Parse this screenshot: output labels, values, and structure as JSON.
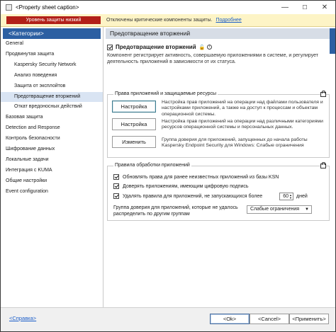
{
  "window": {
    "title": "<Property sheet caption>",
    "min_glyph": "—",
    "max_glyph": "☐",
    "close_glyph": "✕"
  },
  "alert": {
    "badge": "Уровень защиты низкий",
    "text": "Отключены критические компоненты защиты.",
    "link": "Подробнее"
  },
  "sidebar": {
    "header": "<Категории>",
    "items": [
      {
        "label": "General"
      },
      {
        "label": "Продвинутая защита"
      },
      {
        "label": "Kaspersky Security Network"
      },
      {
        "label": "Анализ поведения"
      },
      {
        "label": "Защита от эксплойтов"
      },
      {
        "label": "Предотвращение вторжений"
      },
      {
        "label": "Откат вредоносных действий"
      },
      {
        "label": "Базовая защита"
      },
      {
        "label": "Detection and Response"
      },
      {
        "label": "Контроль безопасности"
      },
      {
        "label": "Шифрование данных"
      },
      {
        "label": "Локальные задачи"
      },
      {
        "label": "Интеграция с KUMA"
      },
      {
        "label": "Общие настройки"
      },
      {
        "label": "Event configuration"
      }
    ]
  },
  "main": {
    "header": "Предотвращение вторжений",
    "feature": {
      "checkbox_checked": true,
      "label": "Предотвращение вторжений",
      "lock_glyph": "🔓",
      "info_glyph": "i",
      "description": "Компонент регистрирует активность, совершаемую приложениями в системе, и регулирует деятельность приложений в зависимости от их статуса."
    },
    "rights_group": {
      "title": "Права приложений и защищаемые ресурсы",
      "buttons": [
        {
          "label": "Настройка",
          "desc": "Настройка прав приложений на операции над файлами пользователя и настройками приложений, а также на доступ к процессам и объектам операционной системы."
        },
        {
          "label": "Настройка",
          "desc": "Настройка прав приложений на операции над различными категориями ресурсов операционной системы и персональных данных."
        },
        {
          "label": "Изменить",
          "desc": "Группа доверия для приложений, запущенных до начала работы Kaspersky Endpoint Security для Windows: Слабые ограничения"
        }
      ]
    },
    "processing_group": {
      "title": "Правила обработки приложений",
      "options": [
        {
          "label": "Обновлять права для ранее неизвестных приложений из базы KSN",
          "checked": true
        },
        {
          "label": "Доверять приложениям, имеющим цифровую подпись",
          "checked": true
        },
        {
          "label": "Удалять правила для приложений, не запускающихся более",
          "checked": true
        }
      ],
      "days_value": "60",
      "days_unit": "дней",
      "trust_label": "Группа доверия для приложений, которые не удалось распределить по другим группам",
      "trust_select": "Слабые ограничения"
    }
  },
  "footer": {
    "help": "<Справка>",
    "ok": "<Ok>",
    "cancel": "<Cancel>",
    "apply": "<Применить>"
  }
}
